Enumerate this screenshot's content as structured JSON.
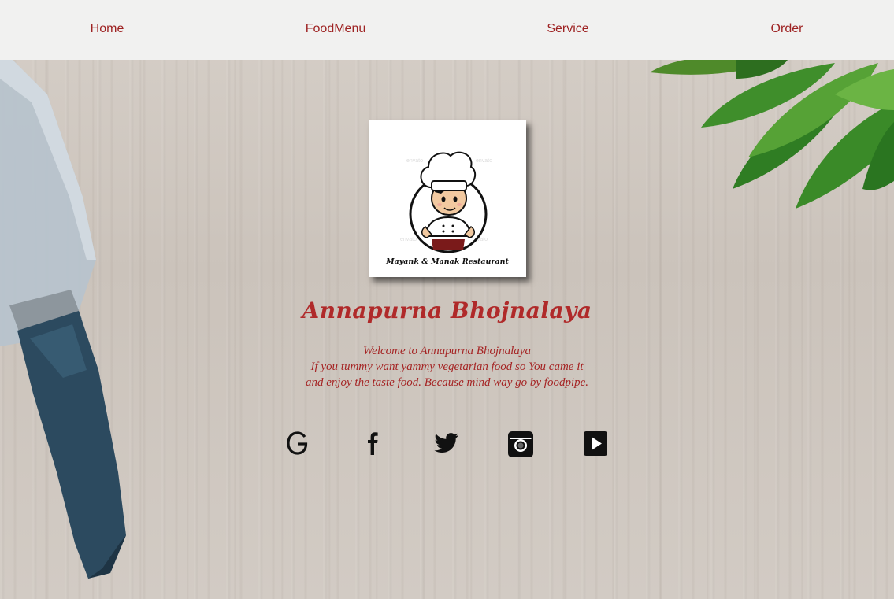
{
  "nav": {
    "items": [
      {
        "label": "Home"
      },
      {
        "label": "FoodMenu"
      },
      {
        "label": "Service"
      },
      {
        "label": "Order"
      }
    ]
  },
  "logo": {
    "caption": "Mayank & Manak Restaurant",
    "watermark": "envato"
  },
  "hero": {
    "title": "Annapurna Bhojnalaya",
    "tagline_lines": [
      "Welcome to Annapurna Bhojnalaya",
      "If you tummy want yammy vegetarian food so You came it",
      "and enjoy the taste food. Because mind way go by foodpipe."
    ]
  },
  "social": [
    {
      "icon": "google-icon"
    },
    {
      "icon": "facebook-icon"
    },
    {
      "icon": "twitter-icon"
    },
    {
      "icon": "instagram-icon"
    },
    {
      "icon": "youtube-icon"
    }
  ],
  "colors": {
    "accent": "#a52424",
    "nav_bg": "#f1f1f0"
  }
}
